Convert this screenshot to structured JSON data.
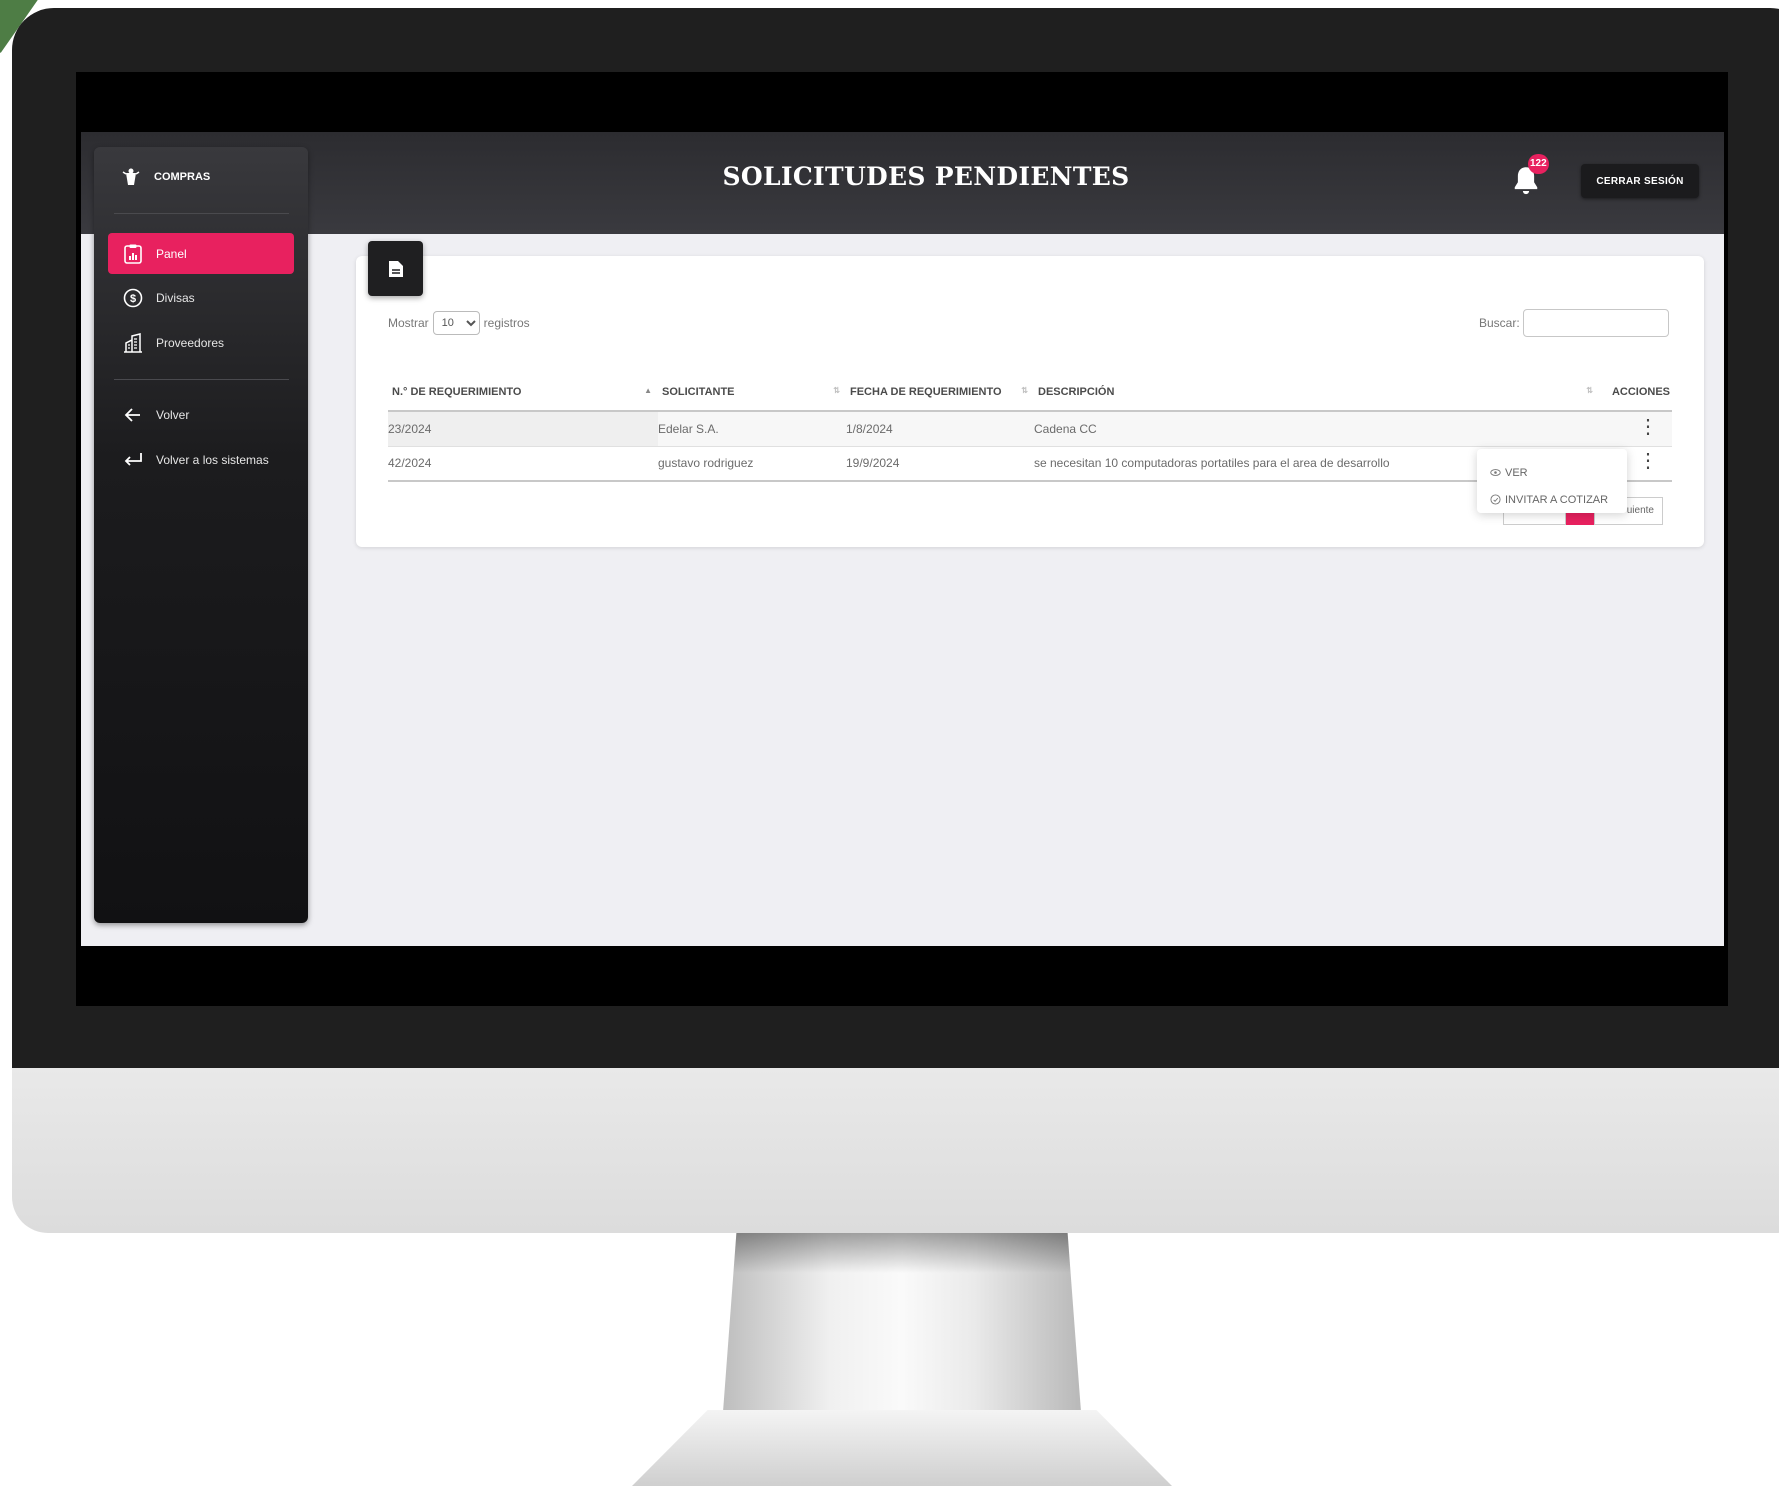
{
  "app": {
    "brand": "COMPRAS",
    "title": "SOLICITUDES PENDIENTES",
    "notifications": "122",
    "logout_label": "CERRAR SESIÓN"
  },
  "sidebar": {
    "items": [
      {
        "label": "Panel",
        "icon": "clipboard-chart-icon",
        "active": true
      },
      {
        "label": "Divisas",
        "icon": "dollar-coin-icon"
      },
      {
        "label": "Proveedores",
        "icon": "building-icon"
      },
      {
        "label": "Volver",
        "icon": "arrow-left-icon"
      },
      {
        "label": "Volver a los sistemas",
        "icon": "return-arrow-icon"
      }
    ]
  },
  "table_controls": {
    "show_label": "Mostrar",
    "page_size": "10",
    "records_label": "registros",
    "search_label": "Buscar:"
  },
  "table": {
    "headers": [
      "N.° DE REQUERIMIENTO",
      "SOLICITANTE",
      "FECHA DE REQUERIMIENTO",
      "DESCRIPCIÓN",
      "ACCIONES"
    ],
    "rows": [
      {
        "id": "23/2024",
        "requester": "Edelar S.A.",
        "date": "1/8/2024",
        "description": "Cadena CC"
      },
      {
        "id": "42/2024",
        "requester": "gustavo rodriguez",
        "date": "19/9/2024",
        "description": "se necesitan 10 computadoras portatiles para el area de desarrollo"
      }
    ]
  },
  "actions_menu": {
    "view": "VER",
    "invite": "INVITAR A COTIZAR"
  },
  "pagination": {
    "next": "uiente"
  },
  "colors": {
    "accent": "#e8215f",
    "dark": "#2c2c30"
  }
}
